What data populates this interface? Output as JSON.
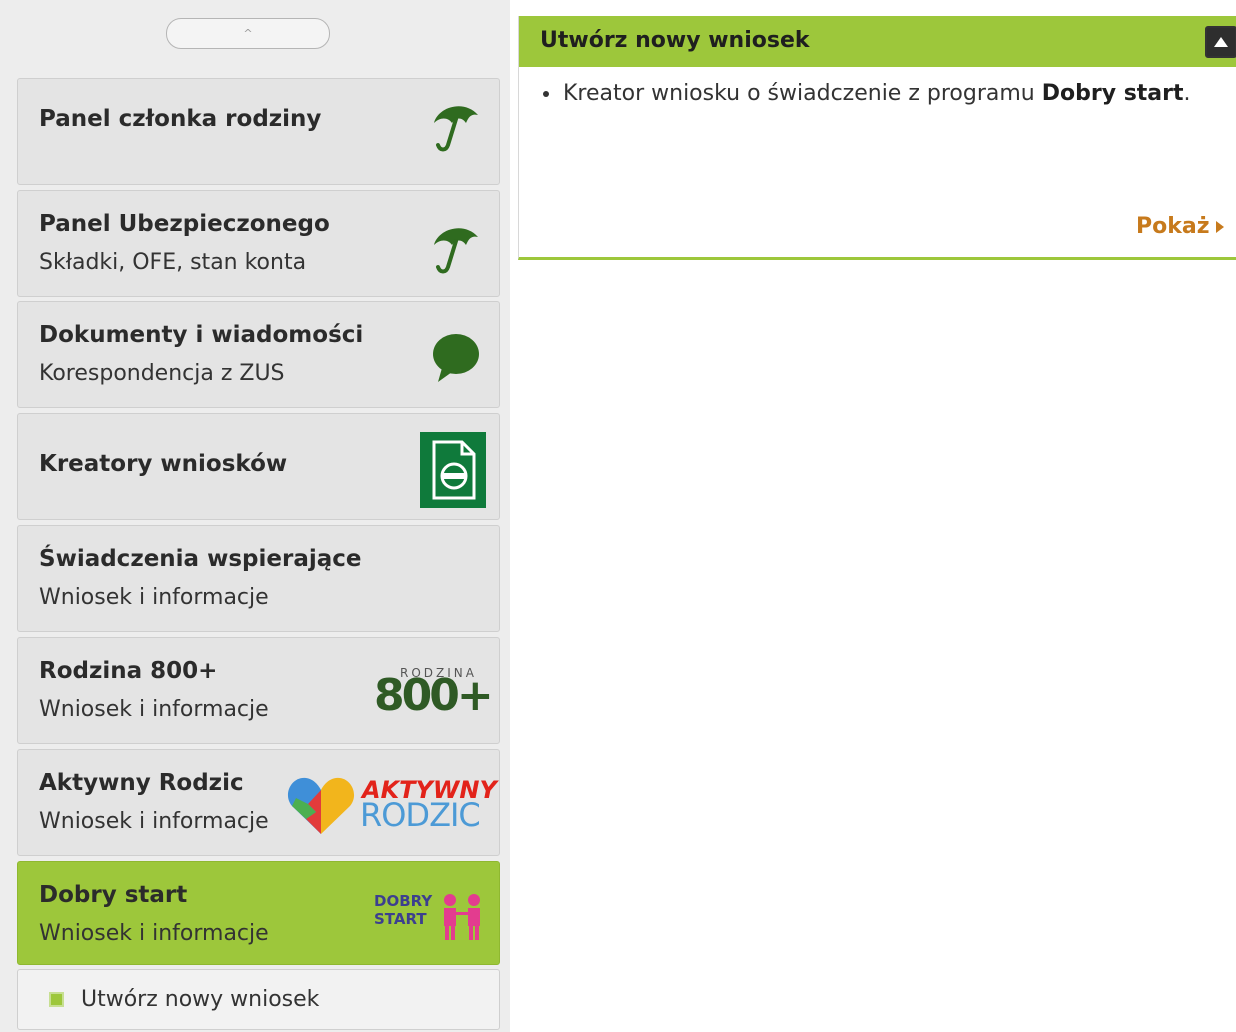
{
  "sidebar": {
    "scroll_up_glyph": "^",
    "items": [
      {
        "title": "Panel członka rodziny",
        "subtitle": "",
        "icon": "umbrella-icon"
      },
      {
        "title": "Panel Ubezpieczonego",
        "subtitle": "Składki, OFE, stan konta",
        "icon": "umbrella-icon"
      },
      {
        "title": "Dokumenty i wiadomości",
        "subtitle": "Korespondencja z ZUS",
        "icon": "speech-bubble-icon"
      },
      {
        "title": "Kreatory wniosków",
        "subtitle": "",
        "icon": "document-form-icon"
      },
      {
        "title": "Świadczenia wspierające",
        "subtitle": "Wniosek i informacje",
        "icon": ""
      },
      {
        "title": "Rodzina 800+",
        "subtitle": "Wniosek i informacje",
        "icon": "rodzina-800-logo",
        "logo_text": {
          "top": "RODZINA",
          "main": "800+"
        }
      },
      {
        "title": "Aktywny Rodzic",
        "subtitle": "Wniosek i informacje",
        "icon": "aktywny-rodzic-logo",
        "logo_text": {
          "top": "AKTYWNY",
          "main": "RODZIC"
        }
      },
      {
        "title": "Dobry start",
        "subtitle": "Wniosek i informacje",
        "icon": "dobry-start-logo",
        "logo_text": {
          "top": "DOBRY",
          "main": "START"
        }
      }
    ],
    "subitem": {
      "label": "Utwórz nowy wniosek"
    }
  },
  "panel": {
    "title": "Utwórz nowy wniosek",
    "list": [
      {
        "prefix": "Kreator wniosku o świadczenie z programu ",
        "bold": "Dobry start",
        "suffix": "."
      }
    ],
    "show_link": "Pokaż"
  },
  "colors": {
    "accent_green": "#9dc73b",
    "icon_green": "#2f6b1f",
    "link_orange": "#c77a1c",
    "sidebar_bg": "#ededed",
    "item_bg": "#e4e4e4"
  }
}
